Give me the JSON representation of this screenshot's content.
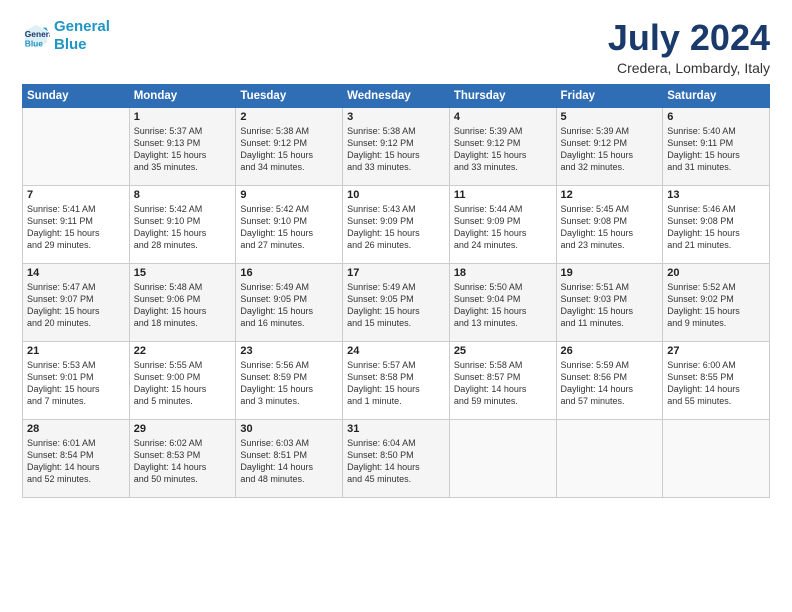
{
  "header": {
    "logo_line1": "General",
    "logo_line2": "Blue",
    "month_title": "July 2024",
    "location": "Credera, Lombardy, Italy"
  },
  "days_of_week": [
    "Sunday",
    "Monday",
    "Tuesday",
    "Wednesday",
    "Thursday",
    "Friday",
    "Saturday"
  ],
  "weeks": [
    [
      {
        "num": "",
        "info": ""
      },
      {
        "num": "1",
        "info": "Sunrise: 5:37 AM\nSunset: 9:13 PM\nDaylight: 15 hours\nand 35 minutes."
      },
      {
        "num": "2",
        "info": "Sunrise: 5:38 AM\nSunset: 9:12 PM\nDaylight: 15 hours\nand 34 minutes."
      },
      {
        "num": "3",
        "info": "Sunrise: 5:38 AM\nSunset: 9:12 PM\nDaylight: 15 hours\nand 33 minutes."
      },
      {
        "num": "4",
        "info": "Sunrise: 5:39 AM\nSunset: 9:12 PM\nDaylight: 15 hours\nand 33 minutes."
      },
      {
        "num": "5",
        "info": "Sunrise: 5:39 AM\nSunset: 9:12 PM\nDaylight: 15 hours\nand 32 minutes."
      },
      {
        "num": "6",
        "info": "Sunrise: 5:40 AM\nSunset: 9:11 PM\nDaylight: 15 hours\nand 31 minutes."
      }
    ],
    [
      {
        "num": "7",
        "info": "Sunrise: 5:41 AM\nSunset: 9:11 PM\nDaylight: 15 hours\nand 29 minutes."
      },
      {
        "num": "8",
        "info": "Sunrise: 5:42 AM\nSunset: 9:10 PM\nDaylight: 15 hours\nand 28 minutes."
      },
      {
        "num": "9",
        "info": "Sunrise: 5:42 AM\nSunset: 9:10 PM\nDaylight: 15 hours\nand 27 minutes."
      },
      {
        "num": "10",
        "info": "Sunrise: 5:43 AM\nSunset: 9:09 PM\nDaylight: 15 hours\nand 26 minutes."
      },
      {
        "num": "11",
        "info": "Sunrise: 5:44 AM\nSunset: 9:09 PM\nDaylight: 15 hours\nand 24 minutes."
      },
      {
        "num": "12",
        "info": "Sunrise: 5:45 AM\nSunset: 9:08 PM\nDaylight: 15 hours\nand 23 minutes."
      },
      {
        "num": "13",
        "info": "Sunrise: 5:46 AM\nSunset: 9:08 PM\nDaylight: 15 hours\nand 21 minutes."
      }
    ],
    [
      {
        "num": "14",
        "info": "Sunrise: 5:47 AM\nSunset: 9:07 PM\nDaylight: 15 hours\nand 20 minutes."
      },
      {
        "num": "15",
        "info": "Sunrise: 5:48 AM\nSunset: 9:06 PM\nDaylight: 15 hours\nand 18 minutes."
      },
      {
        "num": "16",
        "info": "Sunrise: 5:49 AM\nSunset: 9:05 PM\nDaylight: 15 hours\nand 16 minutes."
      },
      {
        "num": "17",
        "info": "Sunrise: 5:49 AM\nSunset: 9:05 PM\nDaylight: 15 hours\nand 15 minutes."
      },
      {
        "num": "18",
        "info": "Sunrise: 5:50 AM\nSunset: 9:04 PM\nDaylight: 15 hours\nand 13 minutes."
      },
      {
        "num": "19",
        "info": "Sunrise: 5:51 AM\nSunset: 9:03 PM\nDaylight: 15 hours\nand 11 minutes."
      },
      {
        "num": "20",
        "info": "Sunrise: 5:52 AM\nSunset: 9:02 PM\nDaylight: 15 hours\nand 9 minutes."
      }
    ],
    [
      {
        "num": "21",
        "info": "Sunrise: 5:53 AM\nSunset: 9:01 PM\nDaylight: 15 hours\nand 7 minutes."
      },
      {
        "num": "22",
        "info": "Sunrise: 5:55 AM\nSunset: 9:00 PM\nDaylight: 15 hours\nand 5 minutes."
      },
      {
        "num": "23",
        "info": "Sunrise: 5:56 AM\nSunset: 8:59 PM\nDaylight: 15 hours\nand 3 minutes."
      },
      {
        "num": "24",
        "info": "Sunrise: 5:57 AM\nSunset: 8:58 PM\nDaylight: 15 hours\nand 1 minute."
      },
      {
        "num": "25",
        "info": "Sunrise: 5:58 AM\nSunset: 8:57 PM\nDaylight: 14 hours\nand 59 minutes."
      },
      {
        "num": "26",
        "info": "Sunrise: 5:59 AM\nSunset: 8:56 PM\nDaylight: 14 hours\nand 57 minutes."
      },
      {
        "num": "27",
        "info": "Sunrise: 6:00 AM\nSunset: 8:55 PM\nDaylight: 14 hours\nand 55 minutes."
      }
    ],
    [
      {
        "num": "28",
        "info": "Sunrise: 6:01 AM\nSunset: 8:54 PM\nDaylight: 14 hours\nand 52 minutes."
      },
      {
        "num": "29",
        "info": "Sunrise: 6:02 AM\nSunset: 8:53 PM\nDaylight: 14 hours\nand 50 minutes."
      },
      {
        "num": "30",
        "info": "Sunrise: 6:03 AM\nSunset: 8:51 PM\nDaylight: 14 hours\nand 48 minutes."
      },
      {
        "num": "31",
        "info": "Sunrise: 6:04 AM\nSunset: 8:50 PM\nDaylight: 14 hours\nand 45 minutes."
      },
      {
        "num": "",
        "info": ""
      },
      {
        "num": "",
        "info": ""
      },
      {
        "num": "",
        "info": ""
      }
    ]
  ]
}
